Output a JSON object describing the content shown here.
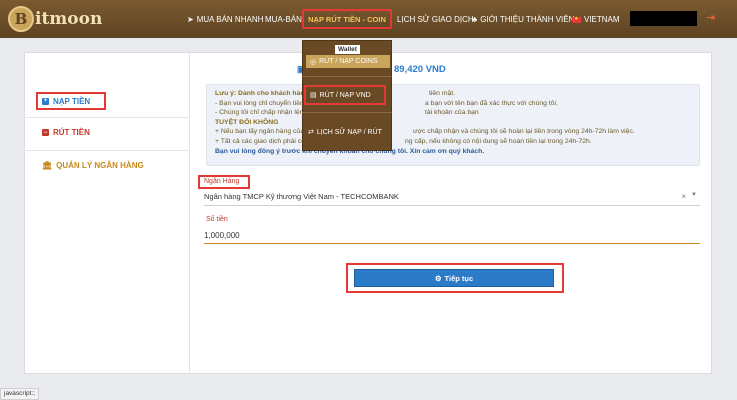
{
  "brand": {
    "logo_letter": "B",
    "logo_text": "itmoon"
  },
  "nav": {
    "buy_sell_fast": "MUA BÁN NHANH",
    "buy_sell": "MUA-BÁN",
    "deposit_withdraw_coin": "NẠP RÚT TIỀN - COIN",
    "history": "LỊCH SỬ GIAO DỊCH",
    "referral": "GIỚI THIỆU THÀNH VIÊN",
    "language": "VIETNAM"
  },
  "dropdown": {
    "header": "Wallet",
    "items": [
      {
        "label": "RÚT / NẠP COINS"
      },
      {
        "label": "RÚT / NẠP VND"
      },
      {
        "label": "LỊCH SỬ NẠP / RÚT"
      }
    ]
  },
  "sidebar": {
    "items": [
      {
        "label": "NẠP TIỀN"
      },
      {
        "label": "RÚT TIỀN"
      },
      {
        "label": "QUẢN LÝ NGÂN HÀNG"
      }
    ]
  },
  "balance": {
    "value": "89,420 VND"
  },
  "notice": {
    "lines": [
      "Lưu ý: Dành cho khách hàng",
      "- Bạn vui lòng chỉ chuyển tiền",
      "- Chúng tôi chỉ chấp nhận lệnh",
      "TUYỆT ĐỐI KHÔNG",
      "+ Nếu bạn lấy ngân hàng của",
      "+ Tất cả các giao dịch phải có",
      "Bạn vui lòng đồng ý trước khi chuyển khoản cho chúng tôi. Xin cảm ơn quý khách."
    ],
    "right_fragments": [
      "tiền mặt.",
      "a bạn với tên bạn đã xác thực với chúng tôi.",
      "tài khoản của bạn",
      "",
      "ược chấp nhận và chúng tôi sẽ hoàn lại tiền trong vòng 24h-72h làm việc.",
      "ng cấp, nếu không có nội dung sẽ hoàn tiền lại trong 24h-72h."
    ]
  },
  "form": {
    "bank_label": "Ngân Hàng",
    "bank_value": "Ngân hàng TMCP Kỹ thương Việt Nam - TECHCOMBANK",
    "amount_label": "Số tiền",
    "amount_value": "1,000,000",
    "submit_label": "Tiếp tục"
  },
  "status_bar": "javascript:;"
}
